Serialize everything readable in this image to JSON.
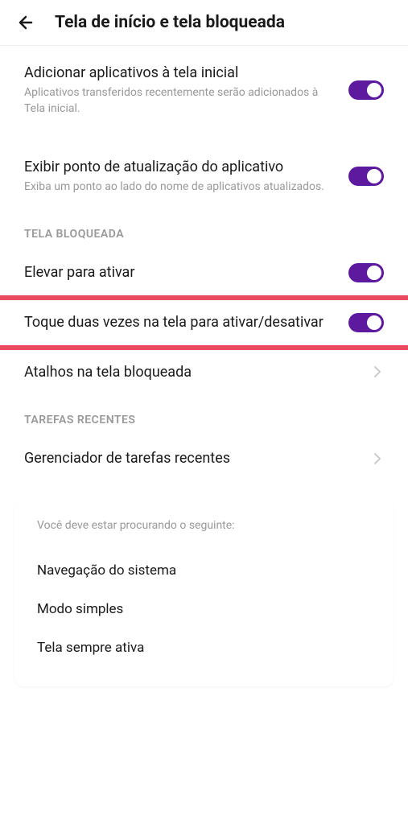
{
  "header": {
    "title": "Tela de início e tela bloqueada"
  },
  "settings": {
    "addApps": {
      "title": "Adicionar aplicativos à tela inicial",
      "subtitle": "Aplicativos transferidos recentemente serão adicionados à Tela inicial."
    },
    "updateDot": {
      "title": "Exibir ponto de atualização do aplicativo",
      "subtitle": "Exiba um ponto ao lado do nome de aplicativos atualizados."
    }
  },
  "sections": {
    "lockScreen": "TELA BLOQUEADA",
    "recentTasks": "TAREFAS RECENTES"
  },
  "lockScreenSettings": {
    "raiseToWake": {
      "title": "Elevar para ativar"
    },
    "doubleTap": {
      "title": "Toque duas vezes na tela para ativar/desativar"
    },
    "shortcuts": {
      "title": "Atalhos na tela bloqueada"
    }
  },
  "recentTasksSettings": {
    "taskManager": {
      "title": "Gerenciador de tarefas recentes"
    }
  },
  "suggestions": {
    "header": "Você deve estar procurando o seguinte:",
    "items": [
      "Navegação do sistema",
      "Modo simples",
      "Tela sempre ativa"
    ]
  }
}
